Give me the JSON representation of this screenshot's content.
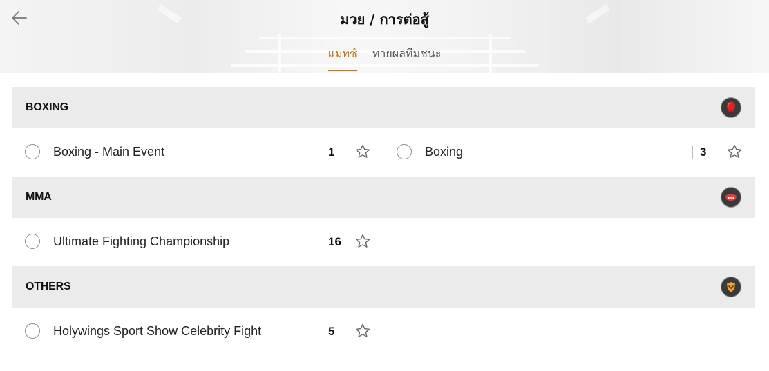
{
  "header": {
    "title": "มวย / การต่อสู้",
    "tabs": [
      {
        "label": "แมทช์",
        "active": true
      },
      {
        "label": "ทายผลทีมชนะ",
        "active": false
      }
    ]
  },
  "colors": {
    "accent": "#b7792a",
    "section_bg": "#ebebeb",
    "icon_bg": "#3a3a3a"
  },
  "sections": [
    {
      "title": "BOXING",
      "icon": "boxing-glove-icon",
      "leagues": [
        {
          "name": "Boxing - Main Event",
          "count": "1"
        },
        {
          "name": "Boxing",
          "count": "3"
        }
      ]
    },
    {
      "title": "MMA",
      "icon": "mouthguard-icon",
      "leagues": [
        {
          "name": "Ultimate Fighting Championship",
          "count": "16"
        }
      ]
    },
    {
      "title": "OTHERS",
      "icon": "shield-icon",
      "leagues": [
        {
          "name": "Holywings Sport Show Celebrity Fight",
          "count": "5"
        }
      ]
    }
  ]
}
